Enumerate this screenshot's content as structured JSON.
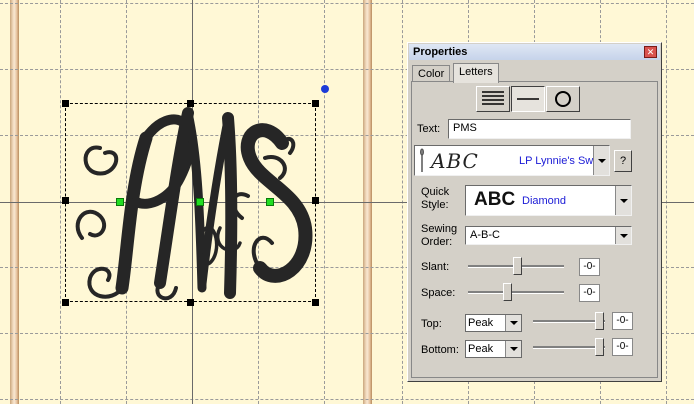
{
  "canvas": {
    "design_text": "PMS",
    "colors": {
      "background": "#fff8d6",
      "thread": "#262626",
      "handles": "#000000",
      "node_handles": "#22dd22",
      "rotate_handle": "#1c3bd8"
    }
  },
  "properties_panel": {
    "title": "Properties",
    "close_icon": "close-icon",
    "tabs": [
      {
        "label": "Color"
      },
      {
        "label": "Letters"
      }
    ],
    "active_tab": "Letters",
    "layout_buttons": [
      "lines-multi-icon",
      "line-straight-icon",
      "circle-icon"
    ],
    "text_label": "Text:",
    "text_value": "PMS",
    "font": {
      "preview": "ABC",
      "name": "LP Lynnie's Swir",
      "help_label": "?"
    },
    "quick_style": {
      "label_line1": "Quick",
      "label_line2": "Style:",
      "preview": "ABC",
      "name": "Diamond"
    },
    "sewing_order": {
      "label_line1": "Sewing",
      "label_line2": "Order:",
      "value": "A-B-C"
    },
    "slant": {
      "label": "Slant:",
      "reset": "-0-"
    },
    "space": {
      "label": "Space:",
      "reset": "-0-"
    },
    "top": {
      "label": "Top:",
      "value": "Peak",
      "reset": "-0-"
    },
    "bottom": {
      "label": "Bottom:",
      "value": "Peak",
      "reset": "-0-"
    },
    "colors": {
      "link_blue": "#1a1ad6",
      "title_bar": "#c6d3ea",
      "panel": "#d4d0c8",
      "close_red": "#d9534f"
    }
  }
}
